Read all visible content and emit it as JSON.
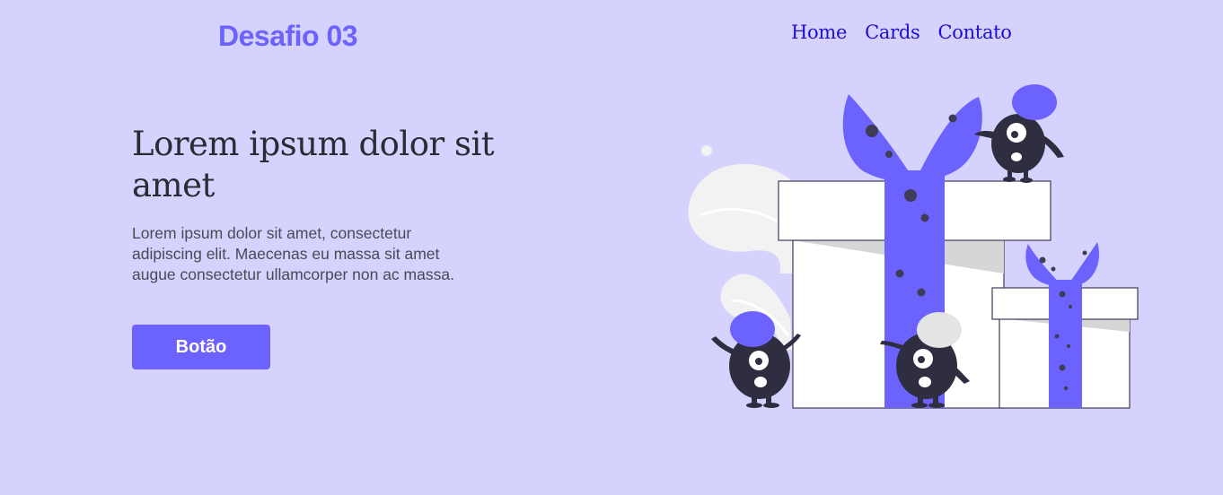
{
  "header": {
    "brand": "Desafio 03",
    "nav": [
      {
        "label": "Home"
      },
      {
        "label": "Cards"
      },
      {
        "label": "Contato"
      }
    ]
  },
  "hero": {
    "title": "Lorem ipsum dolor sit amet",
    "text": "Lorem ipsum dolor sit amet, consectetur adipiscing elit. Maecenas eu massa sit amet augue consectetur ullamcorper non ac massa.",
    "button_label": "Botão"
  },
  "colors": {
    "background": "#d5d2fe",
    "accent": "#6c63ff",
    "nav_link": "#1d0fd1",
    "dark": "#2f2e41"
  },
  "illustration": {
    "icon": "gift-boxes-monsters-illustration"
  }
}
